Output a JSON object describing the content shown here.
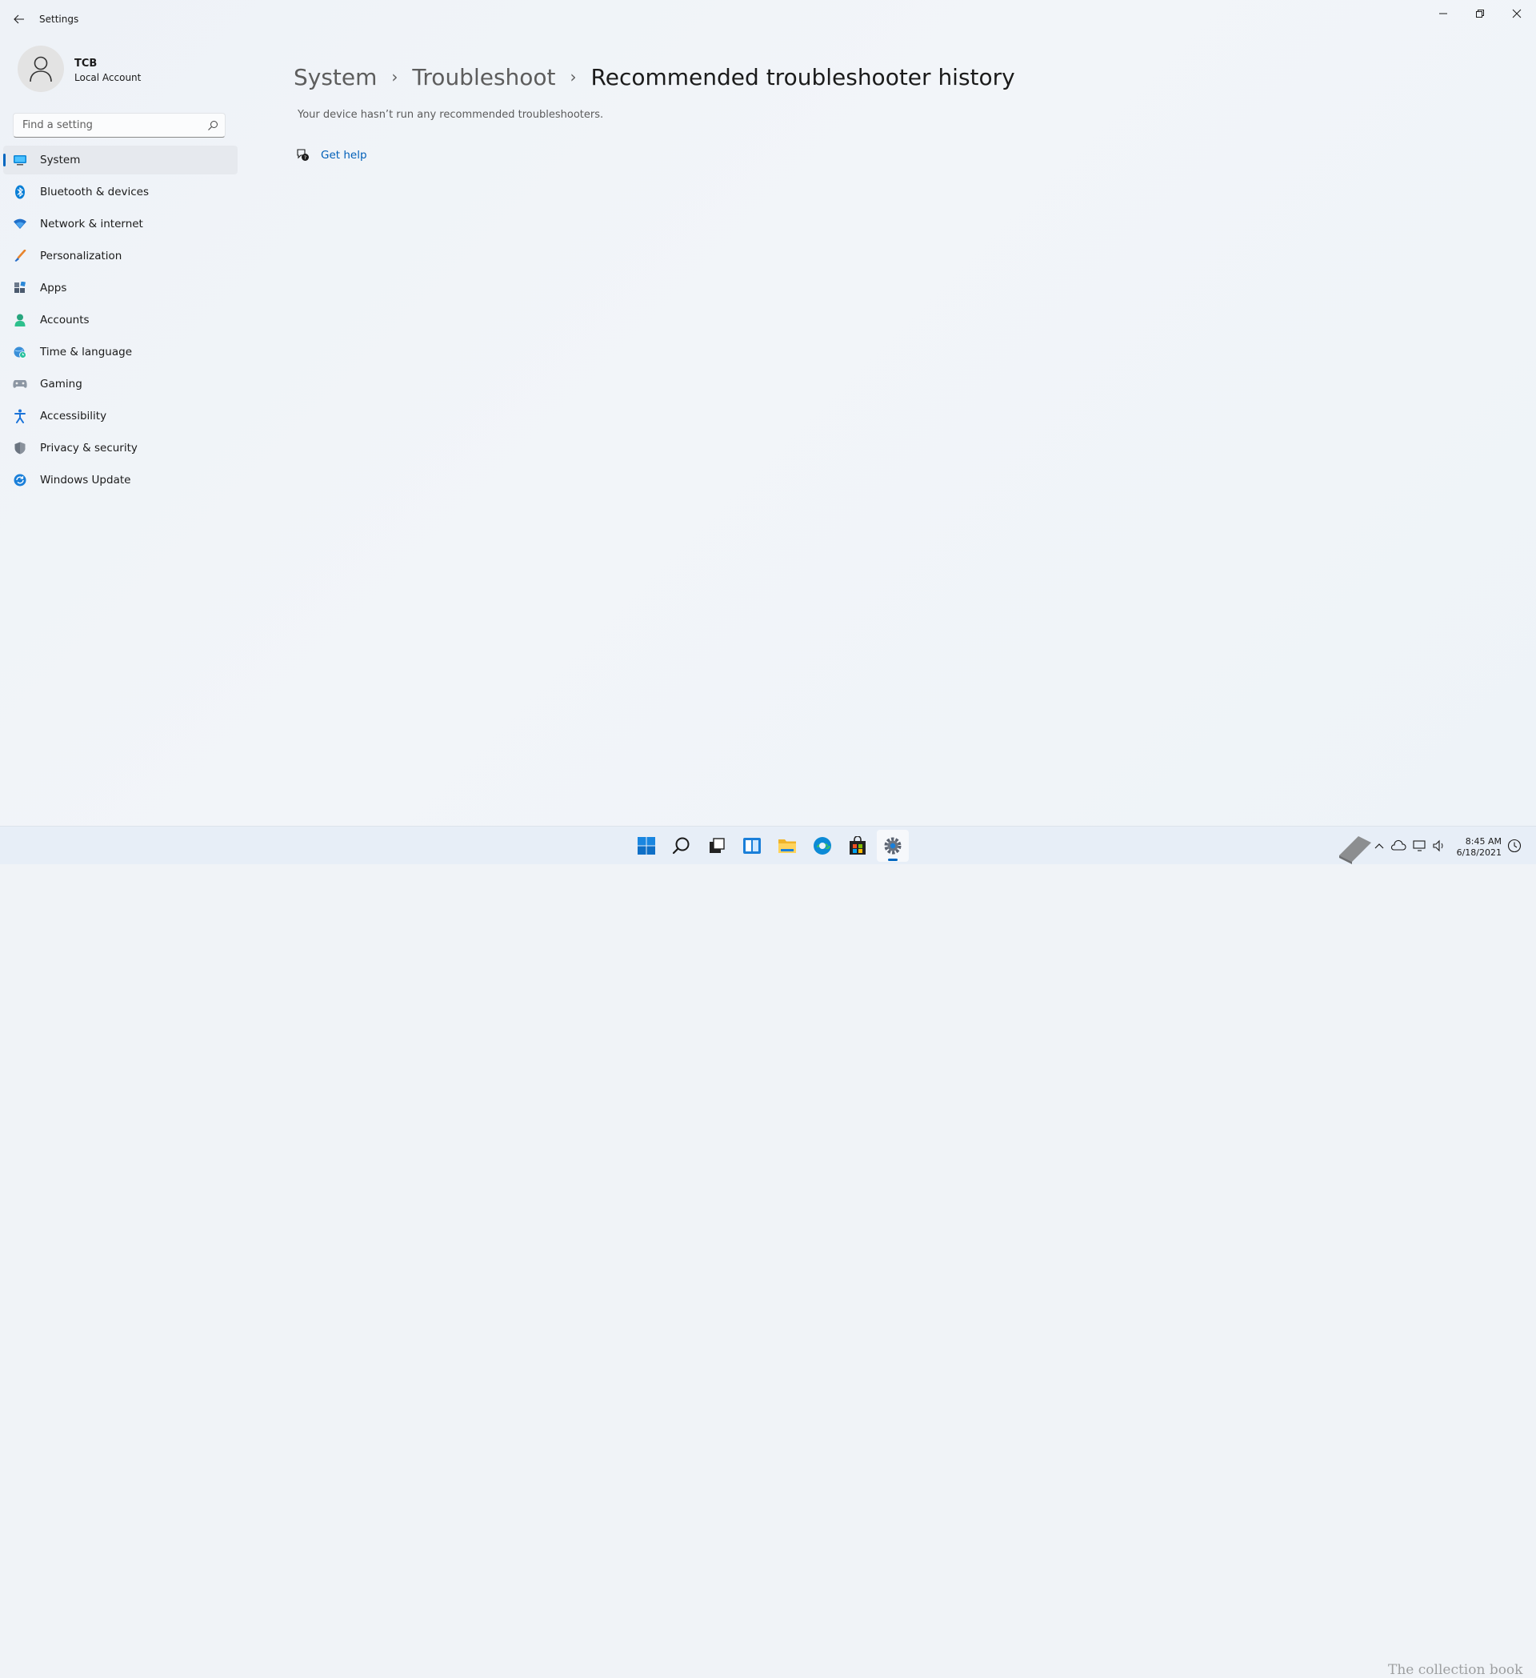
{
  "window": {
    "app_title": "Settings"
  },
  "profile": {
    "name": "TCB",
    "account_type": "Local Account"
  },
  "search": {
    "placeholder": "Find a setting",
    "value": ""
  },
  "sidebar": {
    "items": [
      {
        "label": "System",
        "icon": "system-icon",
        "active": true
      },
      {
        "label": "Bluetooth & devices",
        "icon": "bluetooth-icon"
      },
      {
        "label": "Network & internet",
        "icon": "wifi-icon"
      },
      {
        "label": "Personalization",
        "icon": "brush-icon"
      },
      {
        "label": "Apps",
        "icon": "apps-icon"
      },
      {
        "label": "Accounts",
        "icon": "person-icon"
      },
      {
        "label": "Time & language",
        "icon": "globe-clock-icon"
      },
      {
        "label": "Gaming",
        "icon": "gamepad-icon"
      },
      {
        "label": "Accessibility",
        "icon": "accessibility-icon"
      },
      {
        "label": "Privacy & security",
        "icon": "shield-icon"
      },
      {
        "label": "Windows Update",
        "icon": "update-icon"
      }
    ]
  },
  "breadcrumb": {
    "items": [
      "System",
      "Troubleshoot",
      "Recommended troubleshooter history"
    ],
    "separator": "›"
  },
  "main": {
    "description": "Your device hasn’t run any recommended troubleshooters.",
    "help_link": "Get help"
  },
  "taskbar": {
    "apps": [
      "start-icon",
      "search-icon",
      "task-view-icon",
      "widgets-icon",
      "file-explorer-icon",
      "edge-icon",
      "store-icon",
      "settings-icon"
    ],
    "active_app": "settings-icon",
    "time": "8:45 AM",
    "date": "6/18/2021"
  },
  "watermark": "The collection book",
  "colors": {
    "accent": "#0067c0",
    "link": "#005fb8",
    "background": "#f0f3f7"
  }
}
